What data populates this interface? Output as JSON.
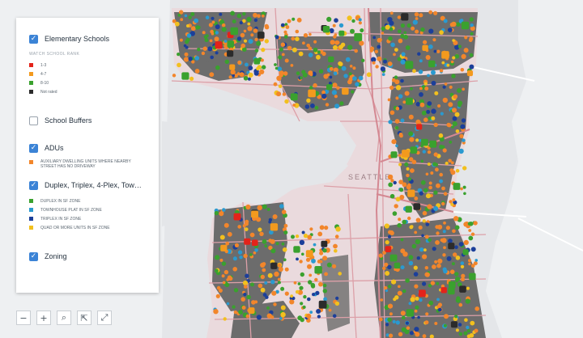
{
  "map": {
    "colors": {
      "water": "#e4e6e9",
      "land": "#eef0f2",
      "city": "#eadadd",
      "parcel_dark": "#6c6c6c",
      "road": "#dca0a8",
      "highway": "#d48892"
    },
    "label": "SEATTLE"
  },
  "legend": {
    "layers": [
      {
        "title": "Elementary Schools",
        "checked": true,
        "subheading": "WATCH SCHOOL RANK",
        "items": [
          {
            "label": "1-3",
            "color": "#e3231a"
          },
          {
            "label": "4-7",
            "color": "#f39a1e"
          },
          {
            "label": "8-10",
            "color": "#3aa12e"
          },
          {
            "label": "Not rated",
            "color": "#2b2b2b"
          }
        ]
      },
      {
        "title": "School Buffers",
        "checked": false,
        "items": []
      },
      {
        "title": "ADUs",
        "checked": true,
        "items": [
          {
            "label": "AUXILIARY DWELLING UNITS WHERE NEARBY STREET HAS NO DRIVEWAY",
            "color": "#f2862b"
          }
        ]
      },
      {
        "title": "Duplex, Triplex, 4-Plex, Tow…",
        "checked": true,
        "items": [
          {
            "label": "DUPLEX IN SF ZONE",
            "color": "#3aa12e"
          },
          {
            "label": "TOWNHOUSE PLAT IN SF ZONE",
            "color": "#2a9ad0"
          },
          {
            "label": "TRIPLEX IN SF ZONE",
            "color": "#1c3f9a"
          },
          {
            "label": "QUAD OR MORE UNITS IN SF ZONE",
            "color": "#f2c01e"
          }
        ]
      },
      {
        "title": "Zoning",
        "checked": true,
        "items": []
      }
    ]
  },
  "controls": {
    "zoom_out": "−",
    "zoom_in": "+",
    "search": "⌕",
    "share": "⇱",
    "fullscreen": "⤢"
  }
}
